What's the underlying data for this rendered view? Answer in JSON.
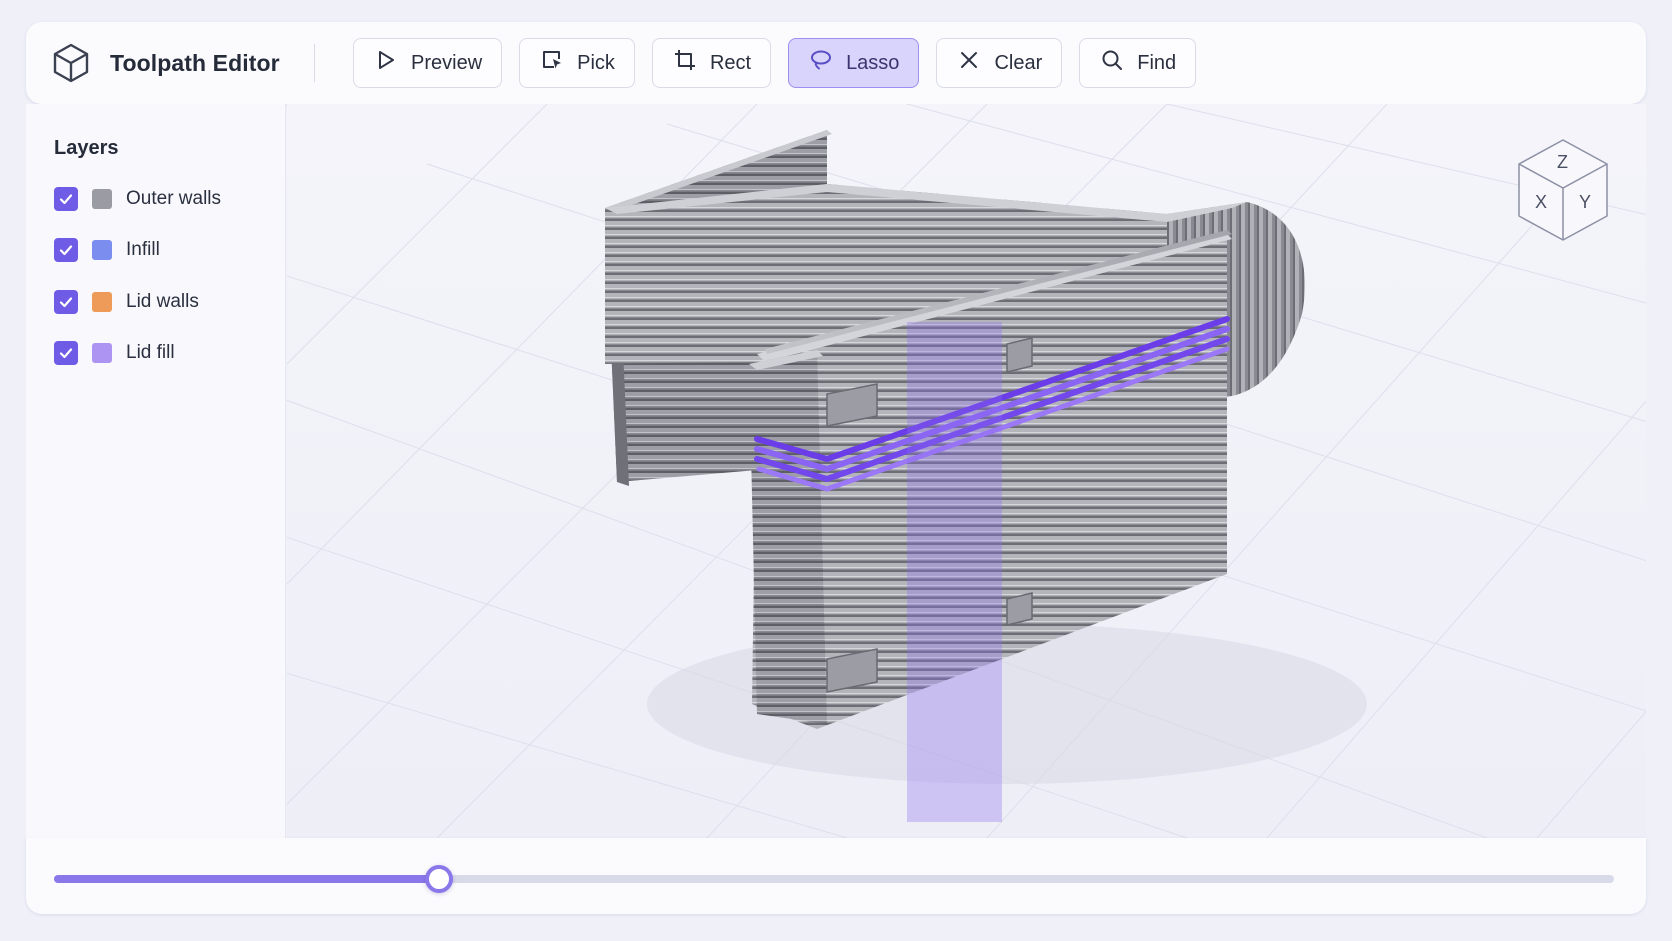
{
  "header": {
    "title": "Toolpath Editor",
    "icon": "cube-icon"
  },
  "toolbar": {
    "buttons": [
      {
        "label": "Preview",
        "icon": "play-icon",
        "active": false
      },
      {
        "label": "Pick",
        "icon": "pick-select-icon",
        "active": false
      },
      {
        "label": "Rect",
        "icon": "rect-select-icon",
        "active": false
      },
      {
        "label": "Lasso",
        "icon": "lasso-icon",
        "active": true
      },
      {
        "label": "Clear",
        "icon": "close-icon",
        "active": false
      },
      {
        "label": "Find",
        "icon": "search-icon",
        "active": false
      }
    ]
  },
  "layers": {
    "title": "Layers",
    "items": [
      {
        "label": "Outer walls",
        "checked": true,
        "color": "#9a9ba3"
      },
      {
        "label": "Infill",
        "checked": true,
        "color": "#7b8ef0"
      },
      {
        "label": "Lid walls",
        "checked": true,
        "color": "#ee9a58"
      },
      {
        "label": "Lid fill",
        "checked": true,
        "color": "#ad94f2"
      }
    ]
  },
  "viewcube": {
    "z": "Z",
    "x": "X",
    "y": "Y"
  },
  "layer_slider": {
    "value_fraction": 0.247
  },
  "colors": {
    "accent": "#6e5ce6",
    "selection": "#7a4df0",
    "model": "#8e8f96"
  }
}
